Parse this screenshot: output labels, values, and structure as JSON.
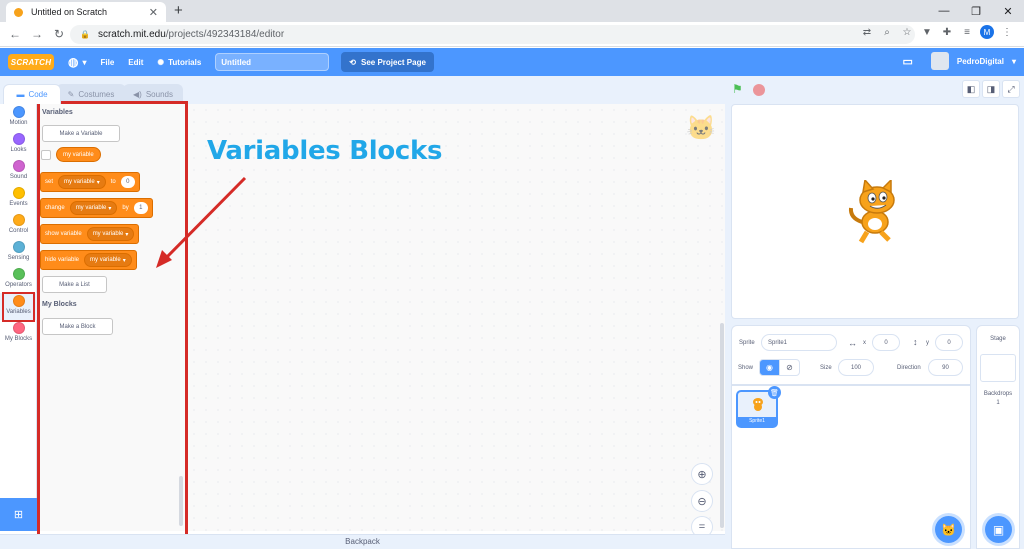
{
  "browser": {
    "tab_title": "Untitled on Scratch",
    "url_host": "scratch.mit.edu",
    "url_path": "/projects/492343184/editor",
    "profile_initial": "M"
  },
  "menubar": {
    "logo": "SCRATCH",
    "file": "File",
    "edit": "Edit",
    "tutorials": "Tutorials",
    "project_title": "Untitled",
    "see_project_page": "See Project Page",
    "username": "PedroDigital"
  },
  "editor_tabs": {
    "code": "Code",
    "costumes": "Costumes",
    "sounds": "Sounds"
  },
  "categories": [
    {
      "label": "Motion",
      "color": "#4c97ff"
    },
    {
      "label": "Looks",
      "color": "#9966ff"
    },
    {
      "label": "Sound",
      "color": "#cf63cf"
    },
    {
      "label": "Events",
      "color": "#ffbf00"
    },
    {
      "label": "Control",
      "color": "#ffab19"
    },
    {
      "label": "Sensing",
      "color": "#5cb1d6"
    },
    {
      "label": "Operators",
      "color": "#59c059"
    },
    {
      "label": "Variables",
      "color": "#ff8c1a"
    },
    {
      "label": "My Blocks",
      "color": "#ff6680"
    }
  ],
  "palette": {
    "variables_title": "Variables",
    "make_variable": "Make a Variable",
    "my_variable": "my variable",
    "set_block": {
      "label": "set",
      "var": "my variable",
      "to": "to",
      "value": "0"
    },
    "change_block": {
      "label": "change",
      "var": "my variable",
      "by": "by",
      "value": "1"
    },
    "show_block": {
      "label": "show variable",
      "var": "my variable"
    },
    "hide_block": {
      "label": "hide variable",
      "var": "my variable"
    },
    "make_list": "Make a List",
    "my_blocks_title": "My Blocks",
    "make_block": "Make a Block"
  },
  "annotation": "Variables Blocks",
  "backpack": "Backpack",
  "sprite_info": {
    "sprite_label": "Sprite",
    "sprite_name": "Sprite1",
    "x_label": "x",
    "x_value": "0",
    "y_label": "y",
    "y_value": "0",
    "show_label": "Show",
    "size_label": "Size",
    "size_value": "100",
    "direction_label": "Direction",
    "direction_value": "90"
  },
  "sprite_tile_name": "Sprite1",
  "stage_panel": {
    "title": "Stage",
    "backdrops_label": "Backdrops",
    "backdrops_count": "1"
  }
}
